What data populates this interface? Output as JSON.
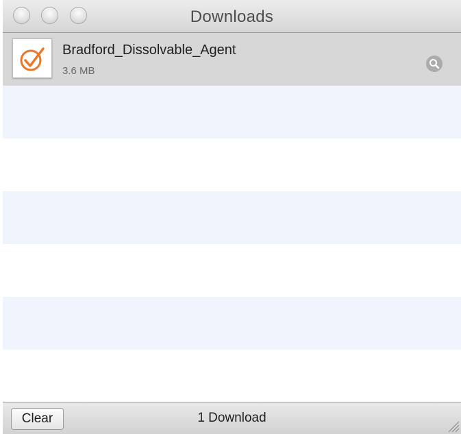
{
  "window": {
    "title": "Downloads"
  },
  "downloads": [
    {
      "name": "Bradford_Dissolvable_Agent",
      "size": "3.6 MB",
      "icon": "orange-checkmark-app-icon",
      "action_icon": "magnifier-icon"
    }
  ],
  "footer": {
    "clear_label": "Clear",
    "count_text": "1 Download"
  },
  "colors": {
    "selected_row": "#d7d7d7",
    "alternate_row": "#f0f5fd",
    "icon_accent": "#e8782a"
  }
}
